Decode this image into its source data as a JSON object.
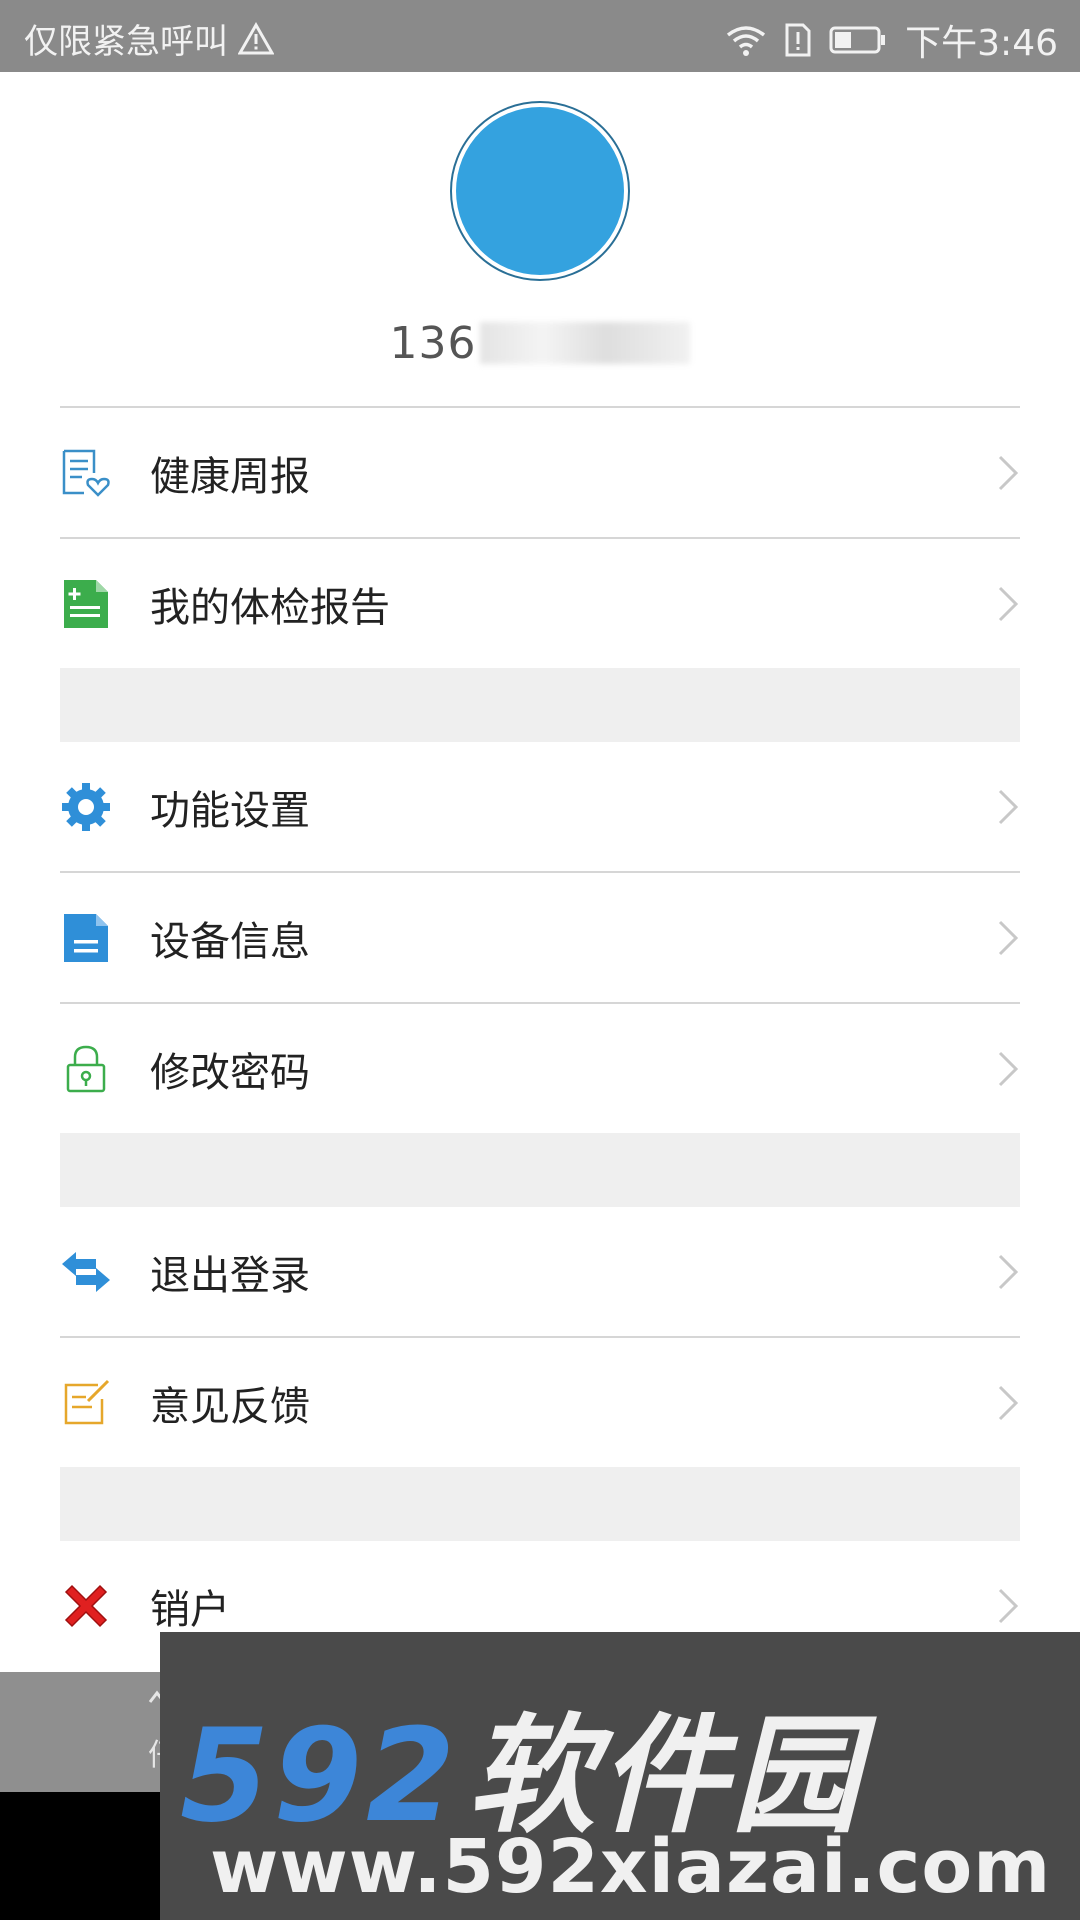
{
  "status_bar": {
    "left_text": "仅限紧急呼叫",
    "time": "下午3:46",
    "icons": [
      "warning-icon",
      "wifi-icon",
      "sim-alert-icon",
      "battery-icon"
    ]
  },
  "profile": {
    "phone_visible": "136",
    "avatar_color": "#34a2df"
  },
  "menu": {
    "items": [
      {
        "label": "健康周报",
        "icon": "health-report-icon",
        "color": "#3a8fc8"
      },
      {
        "label": "我的体检报告",
        "icon": "medical-report-icon",
        "color": "#3cad4c"
      },
      {
        "label": "功能设置",
        "icon": "gear-icon",
        "color": "#2f8fd8"
      },
      {
        "label": "设备信息",
        "icon": "document-icon",
        "color": "#2f8fd8"
      },
      {
        "label": "修改密码",
        "icon": "lock-icon",
        "color": "#3cad4c"
      },
      {
        "label": "退出登录",
        "icon": "swap-arrows-icon",
        "color": "#2f8fd8"
      },
      {
        "label": "意见反馈",
        "icon": "feedback-edit-icon",
        "color": "#e6a72b"
      },
      {
        "label": "销户",
        "icon": "close-x-icon",
        "color": "#e02020"
      }
    ]
  },
  "bottom": {
    "peek_text": "仔"
  },
  "watermark": {
    "logo_number": "592",
    "logo_text": "软件园",
    "url": "www.592xiazai.com"
  }
}
